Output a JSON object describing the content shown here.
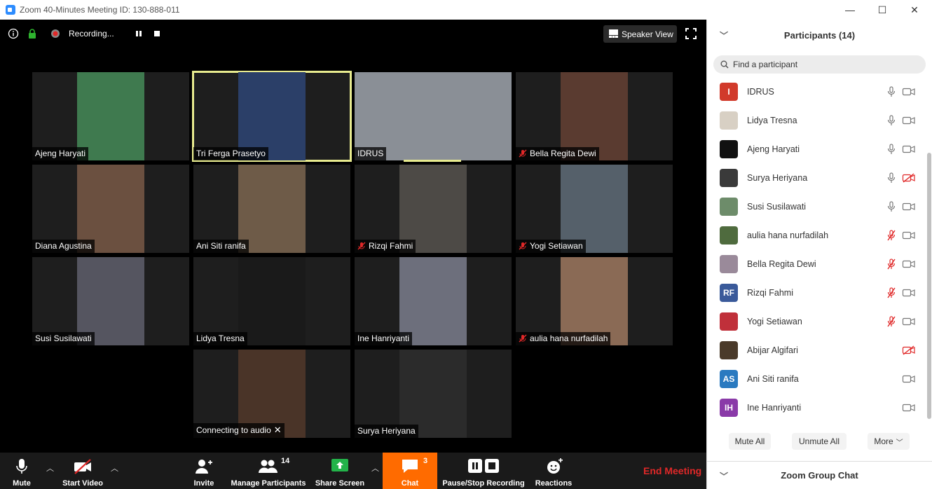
{
  "window": {
    "title": "Zoom 40-Minutes Meeting ID: 130-888-011",
    "minimize": "—",
    "maximize": "☐",
    "close": "✕"
  },
  "topbar": {
    "recording_label": "Recording...",
    "speaker_view_label": "Speaker View"
  },
  "tiles": [
    {
      "name": "Ajeng Haryati",
      "muted": false,
      "video_color": "#3f7a4f"
    },
    {
      "name": "Tri Ferga Prasetyo",
      "muted": false,
      "video_color": "#2b3f68",
      "active": true
    },
    {
      "name": "IDRUS",
      "muted": false,
      "video_color": "#8a8f96"
    },
    {
      "name": "Bella Regita Dewi",
      "muted": true,
      "video_color": "#5a3b30"
    },
    {
      "name": "Diana Agustina",
      "muted": false,
      "video_color": "#6b5040"
    },
    {
      "name": "Ani Siti ranifa",
      "muted": false,
      "video_color": "#6e5b48"
    },
    {
      "name": "Rizqi Fahmi",
      "muted": true,
      "video_color": "#4d4a46"
    },
    {
      "name": "Yogi Setiawan",
      "muted": true,
      "video_color": "#55606a"
    },
    {
      "name": "Susi Susilawati",
      "muted": false,
      "video_color": "#555560"
    },
    {
      "name": "Lidya Tresna",
      "muted": false,
      "video_color": "#1a1a1a"
    },
    {
      "name": "Ine Hanriyanti",
      "muted": false,
      "video_color": "#6d6f7c"
    },
    {
      "name": "aulia hana nurfadilah",
      "muted": true,
      "video_color": "#8a6a55"
    },
    {
      "name": "Connecting to audio",
      "muted": false,
      "video_color": "#4a3428",
      "connecting": true
    },
    {
      "name": "Surya Heriyana",
      "muted": false,
      "video_color": "#2b2b2b"
    }
  ],
  "toolbar": {
    "mute_label": "Mute",
    "start_video_label": "Start Video",
    "invite_label": "Invite",
    "manage_participants_label": "Manage Participants",
    "participant_count": "14",
    "share_screen_label": "Share Screen",
    "chat_label": "Chat",
    "chat_badge": "3",
    "recording_label": "Pause/Stop Recording",
    "reactions_label": "Reactions",
    "end_meeting_label": "End Meeting"
  },
  "panel": {
    "title": "Participants (14)",
    "search_placeholder": "Find a participant",
    "mute_all": "Mute All",
    "unmute_all": "Unmute All",
    "more": "More",
    "chat_title": "Zoom Group Chat",
    "participants": [
      {
        "name": "IDRUS",
        "initials": "I",
        "color": "#d13a2b",
        "mic": "on",
        "cam": "on"
      },
      {
        "name": "Lidya Tresna",
        "initials": "",
        "color": "#d8d0c4",
        "mic": "on",
        "cam": "on"
      },
      {
        "name": "Ajeng Haryati",
        "initials": "",
        "color": "#111111",
        "mic": "on",
        "cam": "on"
      },
      {
        "name": "Surya Heriyana",
        "initials": "",
        "color": "#3a3a3a",
        "mic": "on",
        "cam": "off"
      },
      {
        "name": "Susi Susilawati",
        "initials": "",
        "color": "#6d8c6a",
        "mic": "on",
        "cam": "on"
      },
      {
        "name": "aulia hana nurfadilah",
        "initials": "",
        "color": "#4f6b3e",
        "mic": "off",
        "cam": "on"
      },
      {
        "name": "Bella Regita Dewi",
        "initials": "",
        "color": "#9a8a9a",
        "mic": "off",
        "cam": "on"
      },
      {
        "name": "Rizqi Fahmi",
        "initials": "RF",
        "color": "#3a5a9a",
        "mic": "off",
        "cam": "on"
      },
      {
        "name": "Yogi Setiawan",
        "initials": "",
        "color": "#c0303a",
        "mic": "off",
        "cam": "on"
      },
      {
        "name": "Abijar Algifari",
        "initials": "",
        "color": "#4a3a2a",
        "mic": "none",
        "cam": "off"
      },
      {
        "name": "Ani Siti ranifa",
        "initials": "AS",
        "color": "#2a7ac0",
        "mic": "none",
        "cam": "on"
      },
      {
        "name": "Ine Hanriyanti",
        "initials": "IH",
        "color": "#8a3aa8",
        "mic": "none",
        "cam": "on"
      }
    ]
  }
}
